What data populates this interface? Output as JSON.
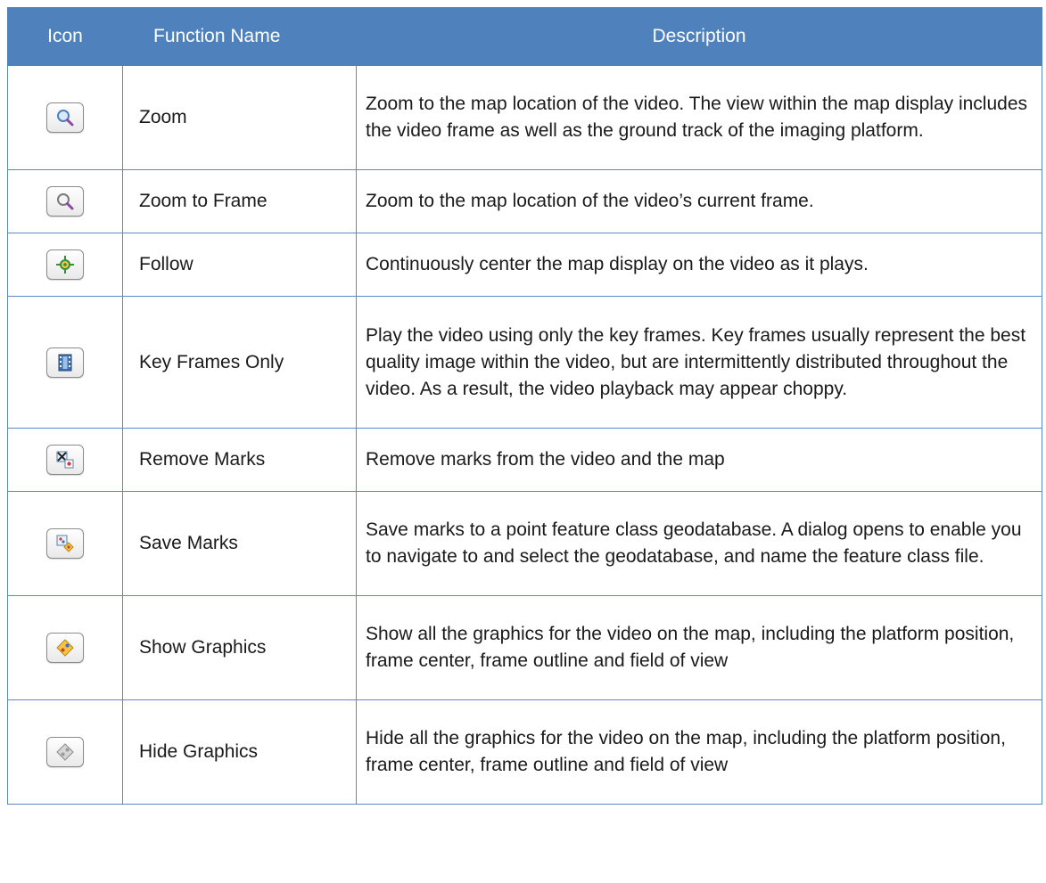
{
  "headers": {
    "icon": "Icon",
    "function_name": "Function Name",
    "description": "Description"
  },
  "rows": [
    {
      "icon": "zoom-icon",
      "name": "Zoom",
      "description": "Zoom to the map location of the video. The view within the map display includes the video frame as well as the ground track of the imaging platform."
    },
    {
      "icon": "zoom-to-frame-icon",
      "name": "Zoom to Frame",
      "description": "Zoom to the map location of the video’s current frame."
    },
    {
      "icon": "follow-icon",
      "name": "Follow",
      "description": "Continuously center the map display on the video as it plays."
    },
    {
      "icon": "key-frames-icon",
      "name": "Key Frames Only",
      "description": "Play the video using only the key frames. Key frames usually represent the best quality image within the video, but are intermittently distributed throughout the video. As a result, the video playback may appear choppy."
    },
    {
      "icon": "remove-marks-icon",
      "name": "Remove Marks",
      "description": "Remove marks from the video and the map"
    },
    {
      "icon": "save-marks-icon",
      "name": "Save Marks",
      "description": "Save marks to a point feature class geodatabase. A dialog opens to enable you to navigate to and select the geodatabase, and name the feature class file."
    },
    {
      "icon": "show-graphics-icon",
      "name": "Show Graphics",
      "description": "Show all the graphics for the video on the map, including the platform position, frame center, frame outline and field of view"
    },
    {
      "icon": "hide-graphics-icon",
      "name": "Hide Graphics",
      "description": "Hide all the graphics for the video on the map, including the platform position, frame center, frame outline and field of view"
    }
  ],
  "colors": {
    "header_bg": "#4f81bd",
    "header_text": "#ffffff",
    "border": "#5b8ac4"
  }
}
